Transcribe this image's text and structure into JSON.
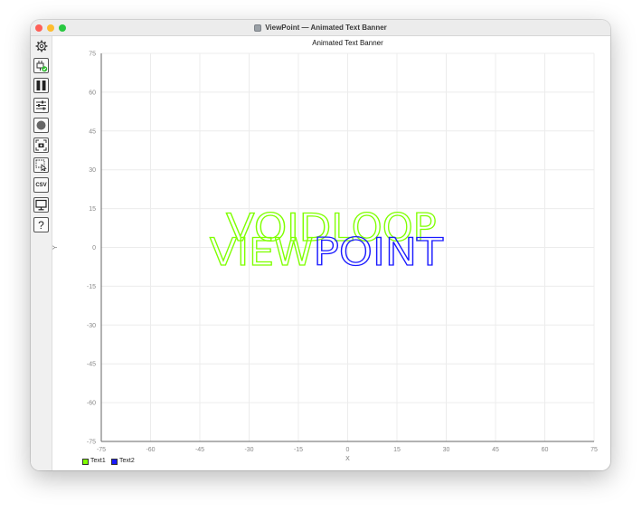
{
  "window": {
    "title": "ViewPoint — Animated Text Banner"
  },
  "toolbar": {
    "buttons": [
      {
        "name": "settings-gear-icon"
      },
      {
        "name": "connect-plug-icon"
      },
      {
        "name": "pause-icon"
      },
      {
        "name": "sliders-icon"
      },
      {
        "name": "record-icon"
      },
      {
        "name": "camera-icon"
      },
      {
        "name": "select-region-icon"
      },
      {
        "name": "csv-button",
        "label": "CSV"
      },
      {
        "name": "monitor-icon"
      },
      {
        "name": "help-icon",
        "label": "?"
      }
    ]
  },
  "chart_data": {
    "type": "scatter",
    "title": "Animated Text Banner",
    "xlabel": "X",
    "ylabel": "Y",
    "xlim": [
      -75,
      75
    ],
    "ylim": [
      -75,
      75
    ],
    "xticks": [
      -75,
      -60,
      -45,
      -30,
      -15,
      0,
      15,
      30,
      45,
      60,
      75
    ],
    "yticks": [
      75,
      60,
      45,
      30,
      15,
      0,
      -15,
      -30,
      -45,
      -60,
      -75
    ],
    "grid": true,
    "legend_position": "bottom-left",
    "series": [
      {
        "name": "Text1",
        "color": "#7fff00",
        "text": "VOIDLOOP",
        "x_start": -37,
        "x_end": 27,
        "y": 7.5
      },
      {
        "name": "Text2",
        "color": "#1a1aff",
        "text": "VIEWPOINT",
        "x_start": -42,
        "x_end": 29,
        "y": -2
      }
    ],
    "segments": [
      {
        "series": "Text1",
        "letters": "VOID",
        "color": "#7fff00"
      },
      {
        "series": "Text1",
        "letters": "LOOP",
        "color": "#7fff00"
      },
      {
        "series": "Text2",
        "letters": "VIEW",
        "color": "#7fff00"
      },
      {
        "series": "Text2",
        "letters": "POINT",
        "color": "#1a1aff"
      }
    ]
  }
}
